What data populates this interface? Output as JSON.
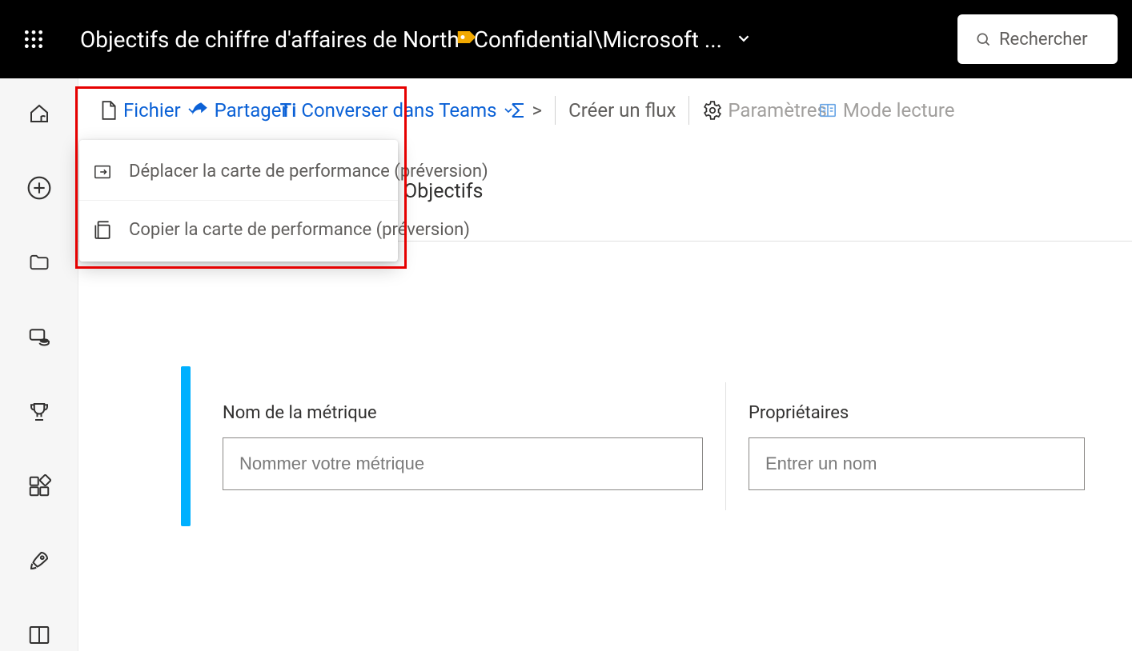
{
  "header": {
    "title_left": "Objectifs de chiffre d'affaires de North",
    "title_right": "Confidential\\Microsoft ...",
    "search_placeholder": "Rechercher"
  },
  "cmdbar": {
    "file": "Fichier",
    "share": "Partager",
    "teams_prefix": "Ti",
    "teams": "Converser dans Teams",
    "create_flow": "Créer un flux",
    "settings": "Paramètres",
    "reading": "Mode lecture"
  },
  "section": {
    "heading": "Objectifs"
  },
  "flyout": {
    "move": "Déplacer la carte de performance (préversion)",
    "copy": "Copier la carte de performance (préversion)"
  },
  "form": {
    "metric_label": "Nom de la métrique",
    "metric_placeholder": "Nommer votre métrique",
    "owners_label": "Propriétaires",
    "owners_placeholder": "Entrer un nom"
  }
}
